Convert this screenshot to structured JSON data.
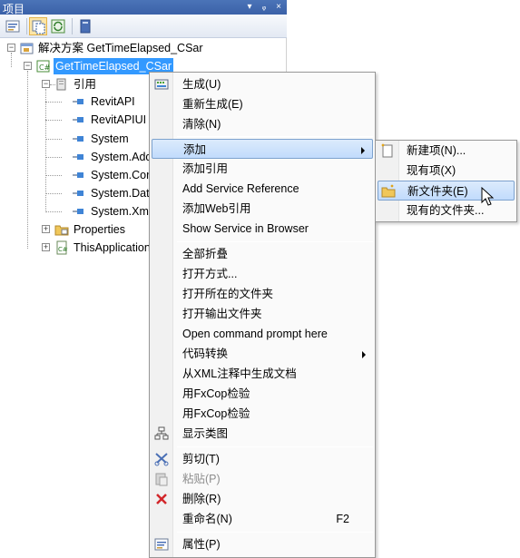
{
  "panel": {
    "title": "项目",
    "title_buttons": [
      "▾",
      "ᵩ",
      "×"
    ]
  },
  "tree": {
    "solution_label": "解决方案 GetTimeElapsed_CSar",
    "project_label": "GetTimeElapsed_CSar",
    "references_label": "引用",
    "references": [
      "RevitAPI",
      "RevitAPIUI",
      "System",
      "System.Add",
      "System.Cor",
      "System.Dat",
      "System.Xm"
    ],
    "properties_label": "Properties",
    "this_app_label": "ThisApplication"
  },
  "context_menu": {
    "build": "生成(U)",
    "rebuild": "重新生成(E)",
    "clean": "清除(N)",
    "add": "添加",
    "add_reference": "添加引用",
    "add_service_reference": "Add Service Reference",
    "add_web_reference": "添加Web引用",
    "show_service_in_browser": "Show Service in Browser",
    "collapse_all": "全部折叠",
    "open_with": "打开方式...",
    "open_folder": "打开所在的文件夹",
    "open_output_folder": "打开输出文件夹",
    "open_command_prompt": "Open command prompt here",
    "code_convert": "代码转换",
    "generate_doc_from_xml": "从XML注释中生成文档",
    "fxcop_check_1": "用FxCop检验",
    "fxcop_check_2": "用FxCop检验",
    "show_class_diagram": "显示类图",
    "cut": "剪切(T)",
    "paste": "粘贴(P)",
    "delete": "删除(R)",
    "rename": "重命名(N)",
    "rename_shortcut": "F2",
    "properties": "属性(P)"
  },
  "submenu": {
    "new_item": "新建项(N)...",
    "existing_item": "现有项(X)",
    "new_folder": "新文件夹(E)",
    "existing_folder": "现有的文件夹..."
  },
  "colors": {
    "selection": "#3399ff",
    "menu_hover": "#c1dbfc",
    "titlebar": "#3b61a8"
  }
}
